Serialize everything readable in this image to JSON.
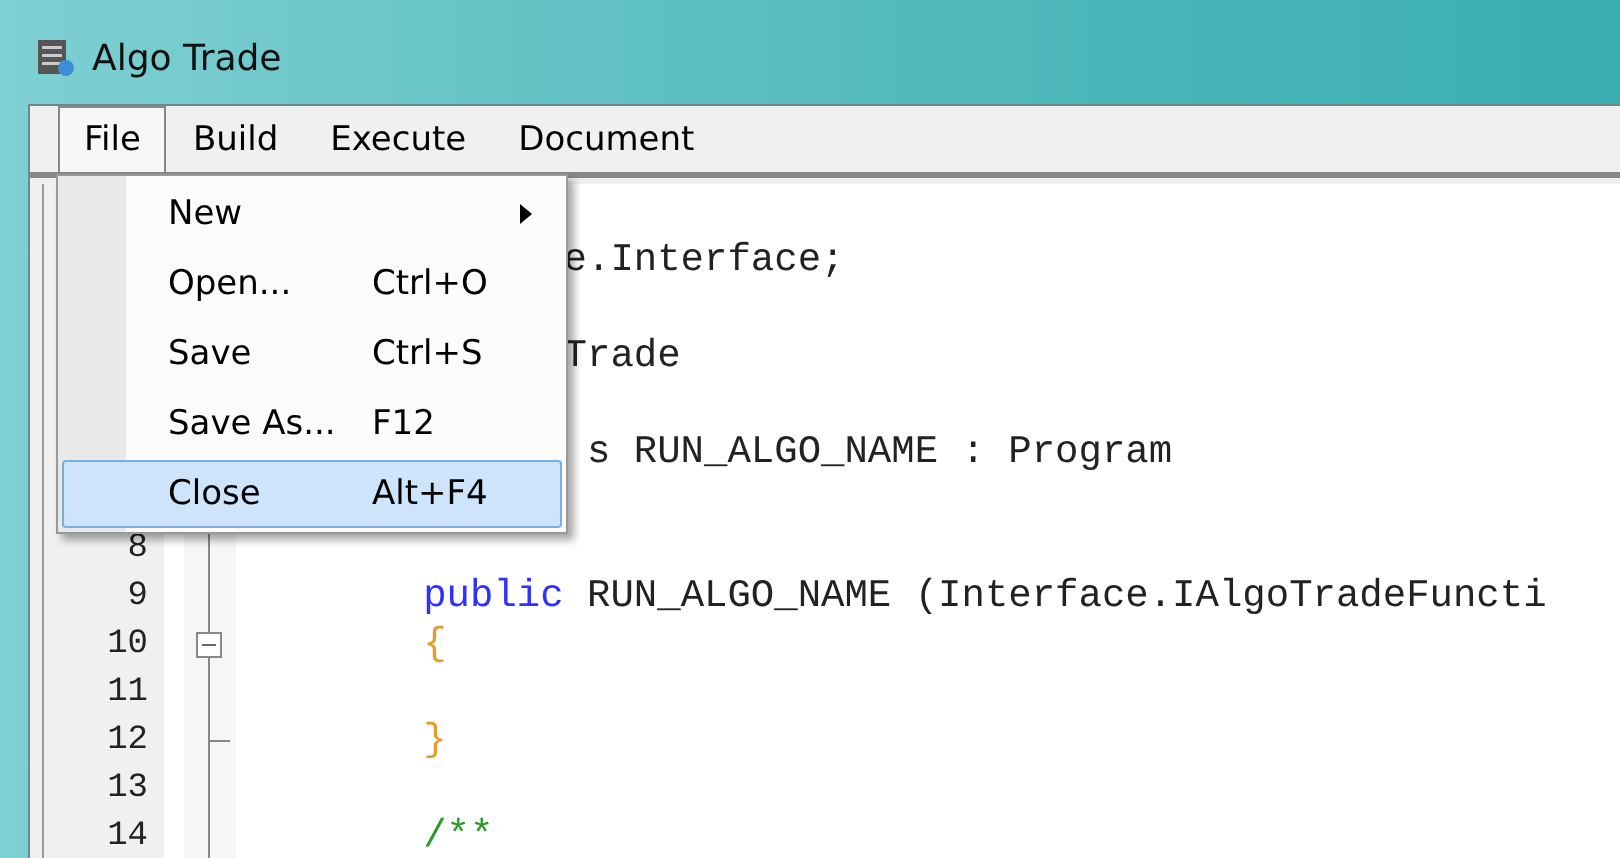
{
  "window": {
    "title": "Algo Trade"
  },
  "menubar": [
    {
      "label": "File",
      "selected": true
    },
    {
      "label": "Build",
      "selected": false
    },
    {
      "label": "Execute",
      "selected": false
    },
    {
      "label": "Document",
      "selected": false
    }
  ],
  "file_menu": [
    {
      "label": "New",
      "submenu": true,
      "selected": false
    },
    {
      "label": "Open...",
      "shortcut": "Ctrl+O",
      "submenu": false,
      "selected": false
    },
    {
      "label": "Save",
      "shortcut": "Ctrl+S",
      "submenu": false,
      "selected": false
    },
    {
      "label": "Save As...",
      "shortcut": "F12",
      "submenu": false,
      "selected": false
    },
    {
      "label": "Close",
      "shortcut": "Alt+F4",
      "submenu": false,
      "selected": true
    }
  ],
  "editor": {
    "lines": [
      {
        "kind": "blank"
      },
      {
        "kind": "blank",
        "text": "              e.Interface;"
      },
      {
        "kind": "blank"
      },
      {
        "kind": "blank",
        "text": "              Trade"
      },
      {
        "kind": "blank"
      },
      {
        "kind": "blank",
        "text": "               s RUN_ALGO_NAME : Program"
      },
      {
        "kind": "blank"
      },
      {
        "number": "8",
        "kind": "fold-line"
      },
      {
        "number": "9",
        "kind": "fold-line",
        "text": "        public RUN_ALGO_NAME (Interface.IAlgoTradeFuncti"
      },
      {
        "number": "10",
        "kind": "fold-box",
        "text": "        {"
      },
      {
        "number": "11",
        "kind": "fold-line"
      },
      {
        "number": "12",
        "kind": "fold-end",
        "text": "        }"
      },
      {
        "number": "13",
        "kind": "fold-line"
      },
      {
        "number": "14",
        "kind": "fold-line",
        "text": "        /**"
      }
    ]
  }
}
